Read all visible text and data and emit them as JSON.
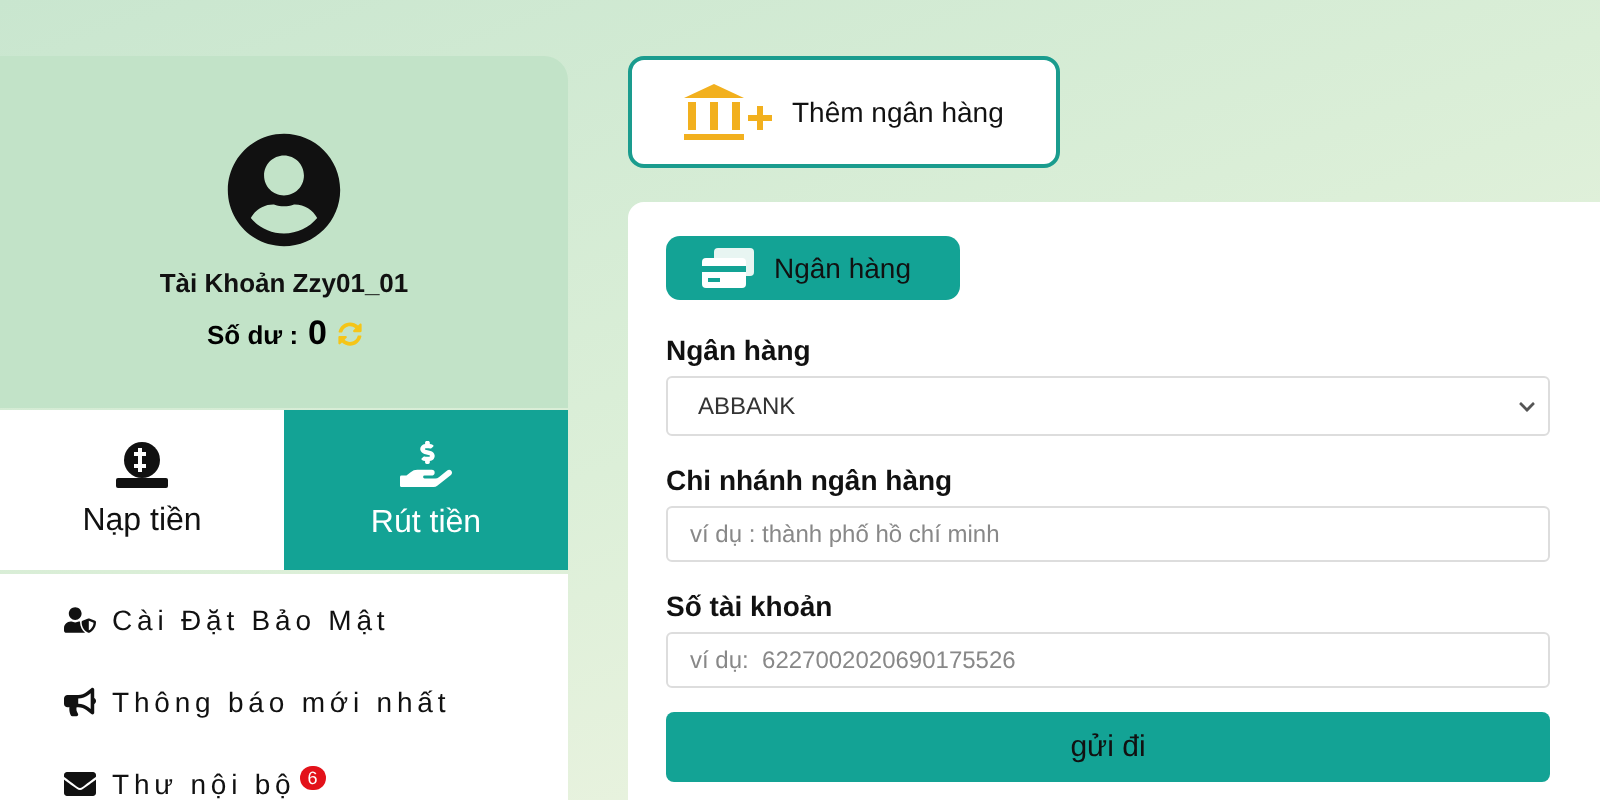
{
  "account": {
    "name": "Tài Khoản Zzy01_01",
    "balance_label": "Số dư :",
    "balance": "0"
  },
  "tabs": [
    {
      "label": "Nạp tiền",
      "selected": false,
      "kind": "deposit"
    },
    {
      "label": "Rút tiền",
      "selected": true,
      "kind": "withdraw"
    }
  ],
  "menu": [
    {
      "label": "Cài Đặt Bảo Mật",
      "kind": "security"
    },
    {
      "label": "Thông báo mới nhất",
      "kind": "notice"
    },
    {
      "label": "Thư nội bộ",
      "kind": "mail",
      "badge": "6"
    }
  ],
  "add_bank_button": "Thêm ngân hàng",
  "form": {
    "tab": {
      "label": "Ngân hàng",
      "selected": true
    },
    "fields": [
      {
        "kind": "select",
        "label": "Ngân hàng",
        "value": "ABBANK"
      },
      {
        "kind": "text",
        "label": "Chi nhánh ngân hàng",
        "placeholder": "ví dụ : thành phố hồ chí minh"
      },
      {
        "kind": "text",
        "label": "Số tài khoản",
        "placeholder": "ví dụ:  6227002020690175526"
      }
    ],
    "submit": "gửi đi"
  }
}
